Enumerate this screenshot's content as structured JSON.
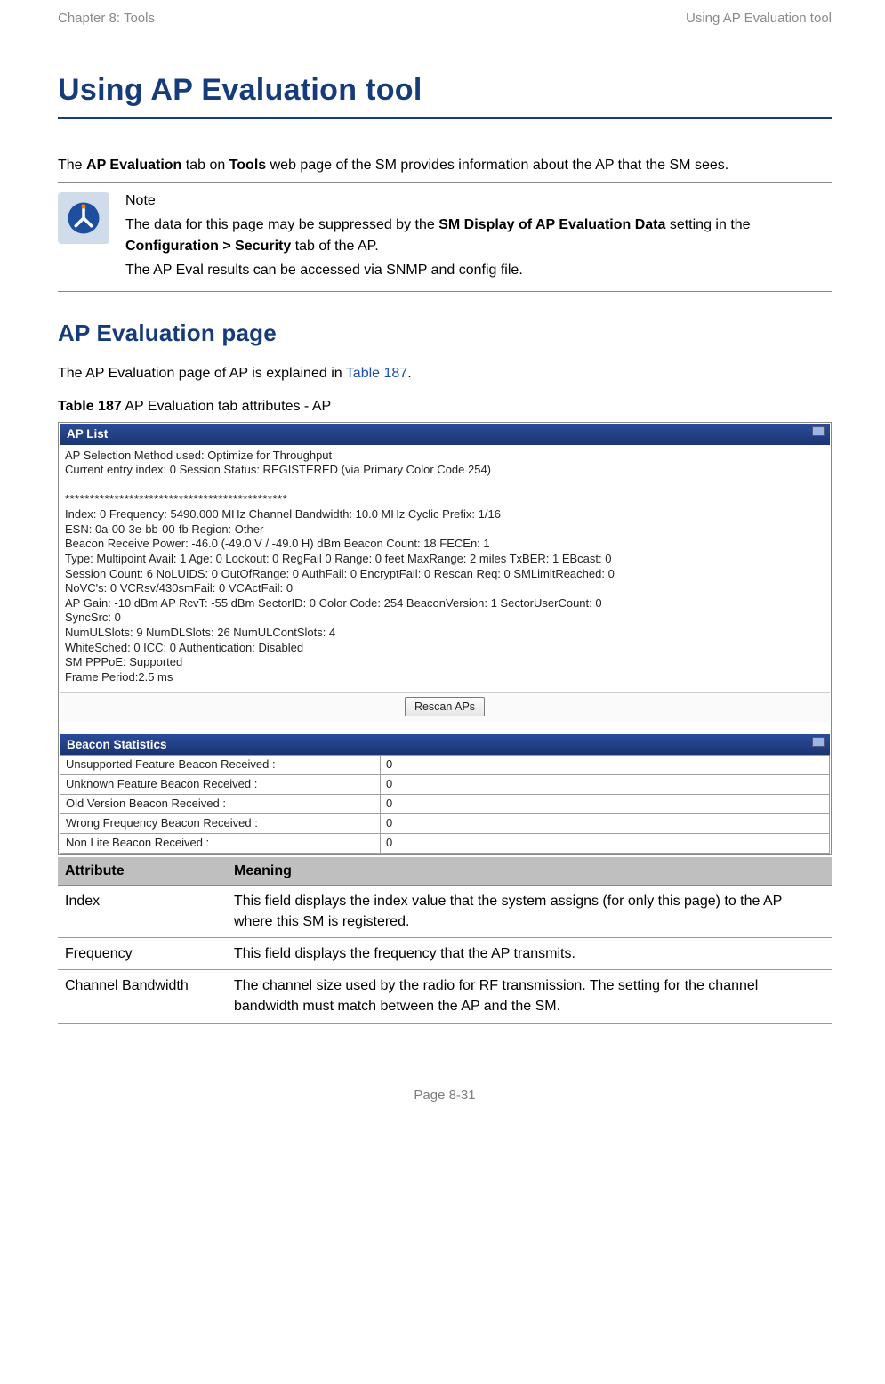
{
  "header": {
    "left": "Chapter 8:  Tools",
    "right": "Using AP Evaluation tool"
  },
  "title": "Using AP Evaluation tool",
  "intro": {
    "pre": "The ",
    "b1": "AP Evaluation",
    "mid1": " tab on ",
    "b2": "Tools",
    "post": " web page of the SM provides information about the AP that the SM sees."
  },
  "note": {
    "label": "Note",
    "l1a": "The data for this page may be suppressed by the ",
    "l1b": "SM Display of AP Evaluation Data",
    "l1c": " setting in the ",
    "l1d": "Configuration > Security",
    "l1e": " tab of the AP.",
    "l2": "The AP Eval results can be accessed via SNMP and config file."
  },
  "h2": "AP Evaluation page",
  "p2a": "The AP Evaluation page of AP is explained in ",
  "p2link": "Table 187",
  "p2b": ".",
  "tablecap_b": "Table 187",
  "tablecap_rest": " AP Evaluation tab attributes - AP",
  "aplist": {
    "header": "AP List",
    "l1": "AP Selection Method used: Optimize for Throughput",
    "l2": "Current entry index: 0 Session Status: REGISTERED (via Primary Color Code 254)",
    "stars": "*********************************************",
    "l3": "Index: 0 Frequency: 5490.000 MHz  Channel Bandwidth: 10.0 MHz  Cyclic Prefix: 1/16",
    "l4": "ESN: 0a-00-3e-bb-00-fb Region: Other",
    "l5": "Beacon Receive Power: -46.0 (-49.0 V / -49.0 H) dBm Beacon Count: 18 FECEn: 1",
    "l6": "Type: Multipoint Avail: 1 Age: 0 Lockout: 0 RegFail 0 Range: 0 feet MaxRange: 2 miles TxBER: 1 EBcast: 0",
    "l7": "Session Count: 6 NoLUIDS: 0 OutOfRange: 0 AuthFail: 0 EncryptFail: 0 Rescan Req: 0 SMLimitReached: 0",
    "l8": "NoVC's: 0 VCRsv/430smFail: 0 VCActFail: 0",
    "l9": "AP Gain: -10 dBm AP RcvT: -55 dBm SectorID: 0 Color Code: 254 BeaconVersion: 1 SectorUserCount: 0",
    "l10": "SyncSrc: 0",
    "l11": "NumULSlots: 9 NumDLSlots: 26 NumULContSlots: 4",
    "l12": "WhiteSched: 0 ICC: 0 Authentication: Disabled",
    "l13": "SM PPPoE: Supported",
    "l14": "Frame Period:2.5 ms",
    "button": "Rescan APs"
  },
  "beacon": {
    "header": "Beacon Statistics",
    "rows": [
      {
        "k": "Unsupported Feature Beacon Received :",
        "v": "0"
      },
      {
        "k": "Unknown Feature Beacon Received :",
        "v": "0"
      },
      {
        "k": "Old Version Beacon Received :",
        "v": "0"
      },
      {
        "k": "Wrong Frequency Beacon Received :",
        "v": "0"
      },
      {
        "k": "Non Lite Beacon Received :",
        "v": "0"
      }
    ]
  },
  "attr": {
    "h1": "Attribute",
    "h2": "Meaning",
    "rows": [
      {
        "a": "Index",
        "m": "This field displays the index value that the system assigns (for only this page) to the AP where this SM is registered."
      },
      {
        "a": "Frequency",
        "m": "This field displays the frequency that the AP transmits."
      },
      {
        "a": "Channel Bandwidth",
        "m": "The channel size used by the radio for RF transmission. The setting for the channel bandwidth must match between the AP and the SM."
      }
    ]
  },
  "footer": "Page 8-31"
}
